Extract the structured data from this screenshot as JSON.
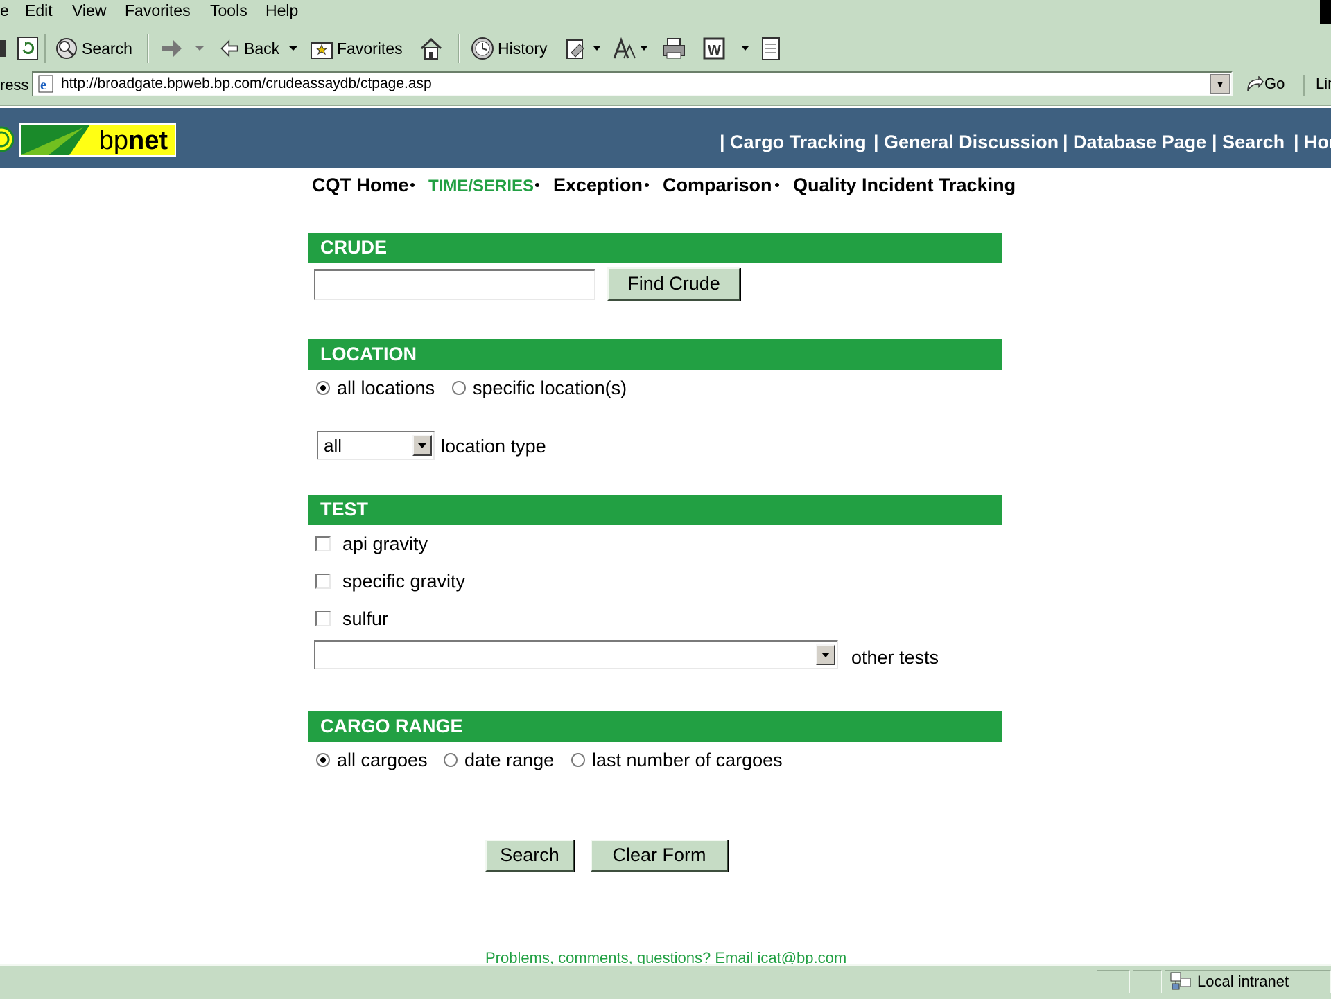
{
  "menu": [
    "e",
    "Edit",
    "View",
    "Favorites",
    "Tools",
    "Help"
  ],
  "toolbar": {
    "search": "Search",
    "back": "Back",
    "favorites": "Favorites",
    "history": "History"
  },
  "address": {
    "label": "ress",
    "url": "http://broadgate.bpweb.bp.com/crudeassaydb/ctpage.asp",
    "go": "Go",
    "links": "Lir"
  },
  "header": {
    "logo_prefix": "bp",
    "logo_bold": "net",
    "nav": [
      "| Cargo Tracking",
      "| General Discussion",
      "| Database Page",
      "| Search",
      "| Hor"
    ]
  },
  "subnav": {
    "items": [
      "CQT Home",
      "TIME/SERIES",
      "Exception",
      "Comparison",
      "Quality Incident Tracking"
    ],
    "active_color": "#22a043"
  },
  "crude": {
    "heading": "CRUDE",
    "input_value": "",
    "find_button": "Find Crude"
  },
  "location": {
    "heading": "LOCATION",
    "all_label": "all locations",
    "specific_label": "specific location(s)",
    "selected": "all locations",
    "type_value": "all",
    "type_label": "location type"
  },
  "test": {
    "heading": "TEST",
    "options": [
      "api gravity",
      "specific gravity",
      "sulfur"
    ],
    "other_value": "",
    "other_label": "other tests"
  },
  "cargo": {
    "heading": "CARGO RANGE",
    "options": [
      "all cargoes",
      "date range",
      "last number of cargoes"
    ],
    "selected": "all cargoes"
  },
  "actions": {
    "search": "Search",
    "clear": "Clear Form"
  },
  "footer": "Problems, comments, questions? Email icat@bp.com",
  "status": {
    "zone": "Local intranet"
  },
  "colors": {
    "chrome": "#c6dcc5",
    "header": "#3e6080",
    "section": "#22a043",
    "logo": "#ffff14"
  }
}
